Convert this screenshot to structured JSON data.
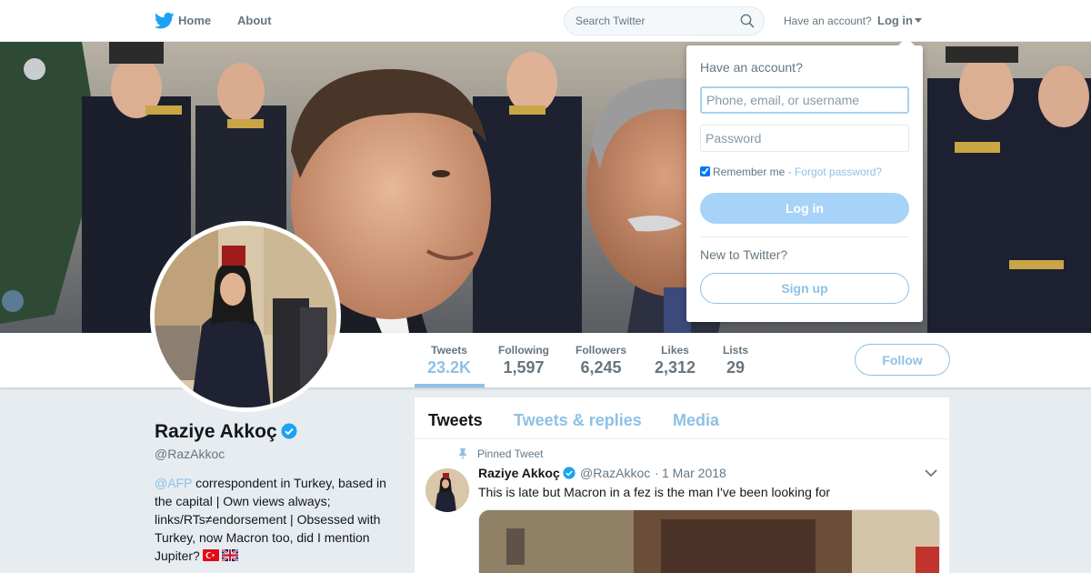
{
  "nav": {
    "home": "Home",
    "about": "About",
    "search_placeholder": "Search Twitter",
    "have_account": "Have an account?",
    "login": "Log in"
  },
  "profile": {
    "name": "Raziye Akkoç",
    "handle": "@RazAkkoc",
    "bio_mention": "@AFP",
    "bio_text": " correspondent in Turkey, based in the capital | Own views always; links/RTs≠endorsement | Obsessed with Turkey, now Macron too, did I mention Jupiter?"
  },
  "stats": [
    {
      "label": "Tweets",
      "value": "23.2K"
    },
    {
      "label": "Following",
      "value": "1,597"
    },
    {
      "label": "Followers",
      "value": "6,245"
    },
    {
      "label": "Likes",
      "value": "2,312"
    },
    {
      "label": "Lists",
      "value": "29"
    }
  ],
  "follow_label": "Follow",
  "timeline": {
    "tabs": [
      "Tweets",
      "Tweets & replies",
      "Media"
    ],
    "pinned_label": "Pinned Tweet",
    "tweet": {
      "name": "Raziye Akkoç",
      "handle": "@RazAkkoc",
      "separator": "·",
      "date": "1 Mar 2018",
      "text": "This is late but Macron in a fez is the man I've been looking for"
    }
  },
  "login_dropdown": {
    "title": "Have an account?",
    "username_placeholder": "Phone, email, or username",
    "password_placeholder": "Password",
    "remember": "Remember me",
    "separator": " · ",
    "forgot": "Forgot password?",
    "login_button": "Log in",
    "new_to": "New to Twitter?",
    "signup_button": "Sign up"
  },
  "colors": {
    "brand": "#1da1f2",
    "link_light": "#8ec1e6",
    "text_muted": "#66757f",
    "background": "#e6ecf0"
  },
  "icons": [
    "twitter-bird-icon",
    "search-icon",
    "caret-down-icon",
    "verified-badge-icon",
    "pin-icon",
    "chevron-down-icon",
    "turkey-flag-icon",
    "uk-flag-icon"
  ]
}
